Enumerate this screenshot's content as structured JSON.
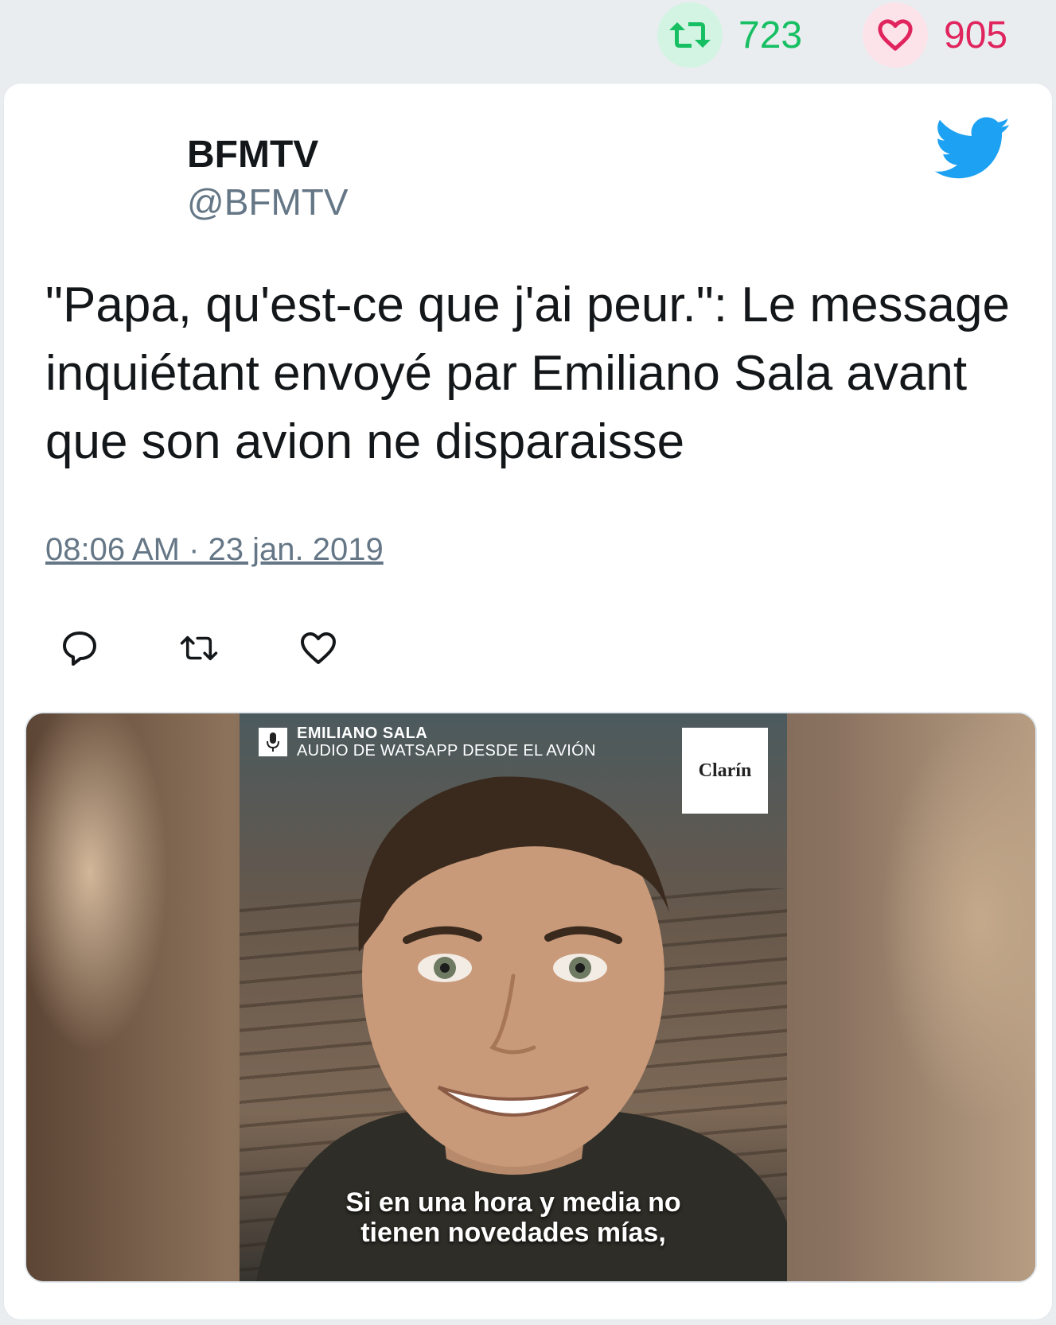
{
  "stats": {
    "retweets_count": "723",
    "likes_count": "905",
    "retweet_icon": "retweet-icon",
    "like_icon": "heart-icon",
    "retweet_color": "#17bf63",
    "like_color": "#e0245e"
  },
  "tweet": {
    "author_name": "BFMTV",
    "author_handle": "@BFMTV",
    "text": "\"Papa, qu'est-ce que j'ai peur.\": Le message inquiétant envoyé par Emiliano Sala avant que son avion ne disparaisse",
    "timestamp": "08:06 AM · 23 jan. 2019",
    "brand_icon": "twitter-bird-icon",
    "brand_color": "#1da1f2"
  },
  "actions": [
    {
      "name": "reply",
      "icon": "reply-icon"
    },
    {
      "name": "retweet",
      "icon": "retweet-icon"
    },
    {
      "name": "like",
      "icon": "heart-icon"
    }
  ],
  "media": {
    "header_title": "EMILIANO SALA",
    "header_subtitle": "AUDIO DE WATSAPP DESDE EL AVIÓN",
    "logo_text": "Clarín",
    "subtitle_line1": "Si en una hora y media no",
    "subtitle_line2": "tienen novedades mías,"
  }
}
